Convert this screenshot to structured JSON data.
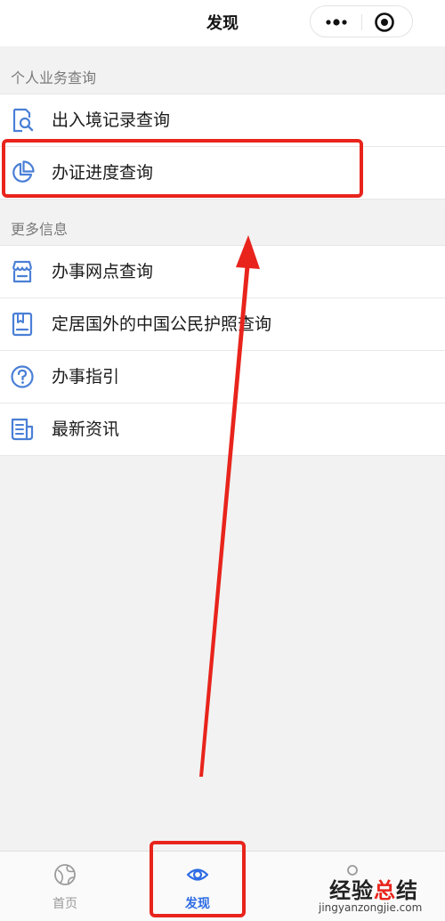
{
  "header": {
    "title": "发现",
    "more_icon": "more-dots-icon",
    "close_icon": "target-circle-icon"
  },
  "sections": [
    {
      "label": "个人业务查询",
      "items": [
        {
          "label": "出入境记录查询",
          "icon": "document-search-icon"
        },
        {
          "label": "办证进度查询",
          "icon": "pie-chart-icon"
        }
      ]
    },
    {
      "label": "更多信息",
      "items": [
        {
          "label": "办事网点查询",
          "icon": "storefront-icon"
        },
        {
          "label": "定居国外的中国公民护照查询",
          "icon": "passport-book-icon"
        },
        {
          "label": "办事指引",
          "icon": "question-circle-icon"
        },
        {
          "label": "最新资讯",
          "icon": "news-document-icon"
        }
      ]
    }
  ],
  "tabbar": {
    "tabs": [
      {
        "label": "首页",
        "icon": "globe-icon",
        "active": false
      },
      {
        "label": "发现",
        "icon": "eye-icon",
        "active": true
      },
      {
        "label": "",
        "icon": "profile-circle-icon",
        "active": false
      }
    ]
  },
  "annotation": {
    "highlight_color": "#e8241c"
  },
  "watermark": {
    "text_dark": "经验",
    "text_accent": "总",
    "text_dark2": "结",
    "url": "jingyanzongjie.com"
  },
  "colors": {
    "accent_blue": "#2d6be4",
    "icon_blue": "#4a7fd6",
    "annotation_red": "#e8241c"
  }
}
